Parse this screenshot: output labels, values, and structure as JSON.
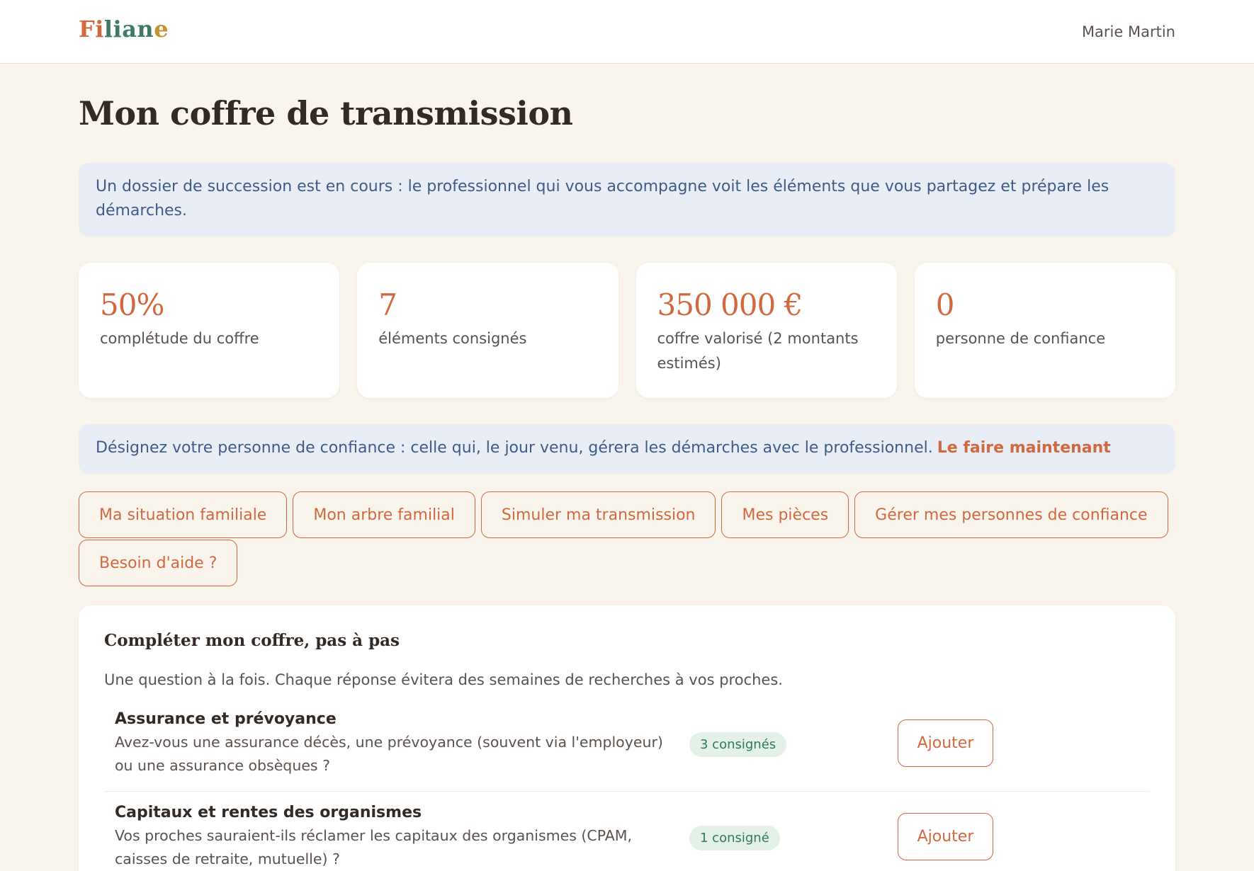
{
  "brand": {
    "letters": [
      "Fi",
      "li",
      "an",
      "e"
    ],
    "colors": [
      "#d2683f",
      "#3f7a67",
      "#c8922e"
    ]
  },
  "header": {
    "user_name": "Marie Martin"
  },
  "page": {
    "title": "Mon coffre de transmission"
  },
  "banner_succession": {
    "text": "Un dossier de succession est en cours : le professionnel qui vous accompagne voit les éléments que vous partagez et prépare les démarches."
  },
  "stats": [
    {
      "value": "50%",
      "label": "complétude du coffre"
    },
    {
      "value": "7",
      "label": "éléments consignés"
    },
    {
      "value": "350 000 €",
      "label": "coffre valorisé (2 montants estimés)"
    },
    {
      "value": "0",
      "label": "personne de confiance"
    }
  ],
  "banner_trust": {
    "text": "Désignez votre personne de confiance : celle qui, le jour venu, gérera les démarches avec le professionnel.",
    "link": "Le faire maintenant"
  },
  "nav": [
    "Ma situation familiale",
    "Mon arbre familial",
    "Simuler ma transmission",
    "Mes pièces",
    "Gérer mes personnes de confiance",
    "Besoin d'aide ?"
  ],
  "panel": {
    "title": "Compléter mon coffre, pas à pas",
    "subtitle": "Une question à la fois. Chaque réponse évitera des semaines de recherches à vos proches.",
    "tasks": [
      {
        "title": "Assurance et prévoyance",
        "description": "Avez-vous une assurance décès, une prévoyance (souvent via l'employeur) ou une assurance obsèques ?",
        "badge": "3 consignés",
        "action": "Ajouter"
      },
      {
        "title": "Capitaux et rentes des organismes",
        "description": "Vos proches sauraient-ils réclamer les capitaux des organismes (CPAM, caisses de retraite, mutuelle) ?",
        "badge": "1 consigné",
        "action": "Ajouter"
      }
    ]
  },
  "colors": {
    "accent": "#d2683f",
    "banner_bg": "#e9eef6",
    "banner_text": "#3e5b8c",
    "page_bg": "#f9f5ec",
    "badge_bg": "#e3f1e9",
    "badge_text": "#2f7a57"
  }
}
